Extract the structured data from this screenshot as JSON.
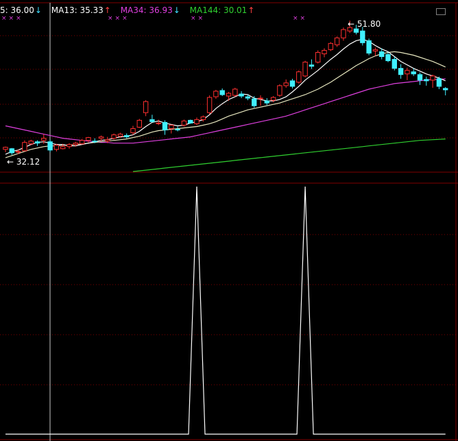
{
  "legend": {
    "ma5": {
      "label": "5: 36.00",
      "arrow": "↓"
    },
    "ma13": {
      "label": "MA13: 35.33",
      "arrow": "↑"
    },
    "ma34": {
      "label": "MA34: 36.93",
      "arrow": "↓"
    },
    "ma144": {
      "label": "MA144: 30.01",
      "arrow": "↑"
    }
  },
  "marks": {
    "g1": "×××",
    "g2": "×××",
    "g3": "××",
    "g4": "××"
  },
  "annotations": {
    "high": "51.80",
    "low": "32.12"
  },
  "colors": {
    "background": "#000000",
    "up": "#ff3030",
    "down": "#40f0ff",
    "ma5": "#ffffff",
    "ma13": "#e8e8c0",
    "ma34": "#e040e0",
    "ma144": "#30d030",
    "grid": "#800000",
    "indicator": "#ffffff"
  },
  "chart_data": [
    {
      "type": "candlestick",
      "ylim": [
        31,
        52
      ],
      "high": 51.8,
      "low": 32.12,
      "candles": [
        [
          33.2,
          33.6,
          32.8,
          33.5
        ],
        [
          33.3,
          33.4,
          32.4,
          32.7
        ],
        [
          32.8,
          33.2,
          32.5,
          32.9
        ],
        [
          33.0,
          34.5,
          32.9,
          34.2
        ],
        [
          34.0,
          34.6,
          33.8,
          34.4
        ],
        [
          34.3,
          34.5,
          33.7,
          34.1
        ],
        [
          34.5,
          35.4,
          34.0,
          34.8
        ],
        [
          34.3,
          34.6,
          32.8,
          33.1
        ],
        [
          33.2,
          34.0,
          32.9,
          33.8
        ],
        [
          33.3,
          34.0,
          33.2,
          33.6
        ],
        [
          33.6,
          34.1,
          33.3,
          33.9
        ],
        [
          33.9,
          34.3,
          33.6,
          34.1
        ],
        [
          34.0,
          34.7,
          33.9,
          34.5
        ],
        [
          34.5,
          35.0,
          34.2,
          34.9
        ],
        [
          34.4,
          34.8,
          34.1,
          34.3
        ],
        [
          34.8,
          35.2,
          34.4,
          35.0
        ],
        [
          34.4,
          35.0,
          34.1,
          34.6
        ],
        [
          34.8,
          35.5,
          34.6,
          35.3
        ],
        [
          35.1,
          35.6,
          34.9,
          35.4
        ],
        [
          35.2,
          35.5,
          34.8,
          35.0
        ],
        [
          35.6,
          36.6,
          35.3,
          36.2
        ],
        [
          36.4,
          37.6,
          36.3,
          37.4
        ],
        [
          38.5,
          40.3,
          38.0,
          40.1
        ],
        [
          37.5,
          38.2,
          37.1,
          37.2
        ],
        [
          37.0,
          37.5,
          36.7,
          37.0
        ],
        [
          37.1,
          37.4,
          35.3,
          36.0
        ],
        [
          36.2,
          36.8,
          35.5,
          36.7
        ],
        [
          36.1,
          36.5,
          35.8,
          36.0
        ],
        [
          36.7,
          37.5,
          36.5,
          37.3
        ],
        [
          37.4,
          37.5,
          36.9,
          37.0
        ],
        [
          36.9,
          37.8,
          36.7,
          37.5
        ],
        [
          37.5,
          38.1,
          37.2,
          37.9
        ],
        [
          38.5,
          41.0,
          38.3,
          40.7
        ],
        [
          40.8,
          41.8,
          40.5,
          41.6
        ],
        [
          41.7,
          42.0,
          40.9,
          41.1
        ],
        [
          40.9,
          41.5,
          40.2,
          41.3
        ],
        [
          41.0,
          42.1,
          40.8,
          41.9
        ],
        [
          41.2,
          41.6,
          40.6,
          40.9
        ],
        [
          40.8,
          41.1,
          40.3,
          40.6
        ],
        [
          40.5,
          40.9,
          39.2,
          39.5
        ],
        [
          40.5,
          41.0,
          39.5,
          40.6
        ],
        [
          40.2,
          40.6,
          39.6,
          39.9
        ],
        [
          40.3,
          40.9,
          40.0,
          40.7
        ],
        [
          41.0,
          42.6,
          40.8,
          42.4
        ],
        [
          42.4,
          43.3,
          42.1,
          42.8
        ],
        [
          43.1,
          43.4,
          42.0,
          42.3
        ],
        [
          42.9,
          44.6,
          42.7,
          44.4
        ],
        [
          43.8,
          46.0,
          43.6,
          45.8
        ],
        [
          45.4,
          46.2,
          44.8,
          45.2
        ],
        [
          45.8,
          47.5,
          45.6,
          47.2
        ],
        [
          47.0,
          47.8,
          46.5,
          47.5
        ],
        [
          47.6,
          48.7,
          47.4,
          48.5
        ],
        [
          48.3,
          49.5,
          48.0,
          49.3
        ],
        [
          49.3,
          50.8,
          48.9,
          50.5
        ],
        [
          50.3,
          51.8,
          50.0,
          50.8
        ],
        [
          50.6,
          51.2,
          49.8,
          50.1
        ],
        [
          50.3,
          50.9,
          48.2,
          48.6
        ],
        [
          48.9,
          49.2,
          46.8,
          47.1
        ],
        [
          47.4,
          47.9,
          46.7,
          47.6
        ],
        [
          47.3,
          47.8,
          46.2,
          46.6
        ],
        [
          46.9,
          47.2,
          45.8,
          46.0
        ],
        [
          46.2,
          46.6,
          44.6,
          44.9
        ],
        [
          44.9,
          45.5,
          43.4,
          44.0
        ],
        [
          44.1,
          45.0,
          43.2,
          44.6
        ],
        [
          44.4,
          44.9,
          43.8,
          44.1
        ],
        [
          44.0,
          44.3,
          42.5,
          43.2
        ],
        [
          43.3,
          43.7,
          42.4,
          43.1
        ],
        [
          43.2,
          44.0,
          42.1,
          43.8
        ],
        [
          43.4,
          43.7,
          41.9,
          42.3
        ],
        [
          42.0,
          42.2,
          41.0,
          41.8
        ]
      ],
      "ma5": [
        32.5,
        32.9,
        33.1,
        33.5,
        33.9,
        34.2,
        34.3,
        34.1,
        33.9,
        33.9,
        33.7,
        33.7,
        33.9,
        34.1,
        34.3,
        34.5,
        34.6,
        34.8,
        35.0,
        35.1,
        35.3,
        35.8,
        36.5,
        37.1,
        37.3,
        37.0,
        36.8,
        36.6,
        36.7,
        37.0,
        37.2,
        37.5,
        38.2,
        39.1,
        39.8,
        40.4,
        40.8,
        41.2,
        41.1,
        40.6,
        40.4,
        40.2,
        40.2,
        40.4,
        40.8,
        41.5,
        42.3,
        43.2,
        43.9,
        44.6,
        45.4,
        46.2,
        46.9,
        47.7,
        48.4,
        48.9,
        49.1,
        48.8,
        48.2,
        47.7,
        47.3,
        46.6,
        45.9,
        45.4,
        44.9,
        44.5,
        44.1,
        43.8,
        43.5,
        43.1
      ],
      "ma13": [
        32.0,
        32.3,
        32.6,
        32.9,
        33.2,
        33.4,
        33.6,
        33.7,
        33.7,
        33.8,
        33.8,
        33.9,
        34.0,
        34.1,
        34.2,
        34.3,
        34.4,
        34.5,
        34.6,
        34.7,
        34.9,
        35.1,
        35.4,
        35.7,
        35.9,
        36.0,
        36.1,
        36.2,
        36.3,
        36.4,
        36.5,
        36.7,
        36.9,
        37.2,
        37.6,
        38.0,
        38.3,
        38.6,
        38.9,
        39.1,
        39.3,
        39.5,
        39.7,
        39.9,
        40.2,
        40.5,
        40.8,
        41.1,
        41.5,
        41.9,
        42.4,
        42.9,
        43.5,
        44.1,
        44.7,
        45.3,
        45.8,
        46.3,
        46.7,
        47.0,
        47.2,
        47.3,
        47.2,
        47.0,
        46.8,
        46.5,
        46.2,
        45.9,
        45.5,
        45.1
      ],
      "ma34": [
        36.6,
        36.4,
        36.2,
        36.0,
        35.8,
        35.6,
        35.4,
        35.2,
        35.0,
        34.8,
        34.7,
        34.6,
        34.5,
        34.4,
        34.3,
        34.2,
        34.2,
        34.1,
        34.1,
        34.1,
        34.1,
        34.2,
        34.3,
        34.4,
        34.5,
        34.6,
        34.7,
        34.8,
        34.9,
        35.0,
        35.2,
        35.4,
        35.6,
        35.8,
        36.0,
        36.2,
        36.4,
        36.6,
        36.8,
        37.0,
        37.2,
        37.4,
        37.6,
        37.8,
        38.0,
        38.3,
        38.6,
        38.9,
        39.2,
        39.5,
        39.8,
        40.1,
        40.4,
        40.7,
        41.0,
        41.3,
        41.6,
        41.9,
        42.1,
        42.3,
        42.5,
        42.7,
        42.8,
        42.9,
        43.0,
        43.1,
        43.2,
        43.3,
        43.3,
        43.4
      ],
      "ma144": [
        null,
        null,
        null,
        null,
        null,
        null,
        null,
        null,
        null,
        null,
        null,
        null,
        null,
        null,
        null,
        null,
        null,
        null,
        null,
        null,
        30.0,
        30.1,
        30.2,
        30.3,
        30.4,
        30.5,
        30.6,
        30.7,
        30.8,
        30.9,
        31.0,
        31.1,
        31.2,
        31.3,
        31.4,
        31.5,
        31.6,
        31.7,
        31.8,
        31.9,
        32.0,
        32.1,
        32.2,
        32.3,
        32.4,
        32.5,
        32.6,
        32.7,
        32.8,
        32.9,
        33.0,
        33.1,
        33.2,
        33.3,
        33.4,
        33.5,
        33.6,
        33.7,
        33.8,
        33.9,
        34.0,
        34.1,
        34.2,
        34.3,
        34.4,
        34.5,
        34.55,
        34.6,
        34.65,
        34.7
      ]
    },
    {
      "type": "line",
      "ylim": [
        0,
        1
      ],
      "values": [
        0,
        0,
        0,
        0,
        0,
        0,
        0,
        0,
        0,
        0,
        0,
        0,
        0,
        0,
        0,
        0,
        0,
        0,
        0,
        0,
        0,
        0,
        0,
        0,
        0,
        0,
        0,
        0,
        0,
        0,
        1,
        0,
        0,
        0,
        0,
        0,
        0,
        0,
        0,
        0,
        0,
        0,
        0,
        0,
        0,
        0,
        0,
        1,
        0,
        0,
        0,
        0,
        0,
        0,
        0,
        0,
        0,
        0,
        0,
        0,
        0,
        0,
        0,
        0,
        0,
        0,
        0,
        0,
        0,
        0
      ]
    }
  ]
}
